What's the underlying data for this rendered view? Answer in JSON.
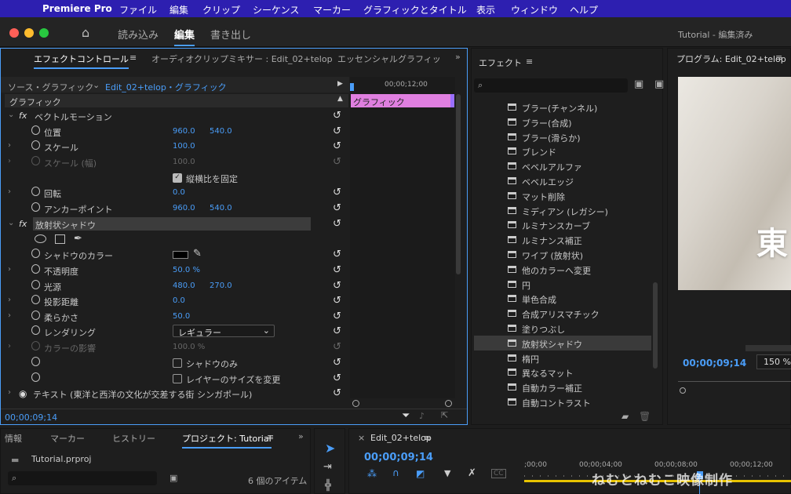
{
  "menubar": {
    "app": "Premiere Pro",
    "items": [
      "ファイル",
      "編集",
      "クリップ",
      "シーケンス",
      "マーカー",
      "グラフィックとタイトル",
      "表示",
      "ウィンドウ",
      "ヘルプ"
    ]
  },
  "workspace": {
    "tabs": [
      "読み込み",
      "編集",
      "書き出し"
    ],
    "active": "編集",
    "project_title": "Tutorial - 編集済み"
  },
  "effect_controls": {
    "tabs": [
      "エフェクトコントロール",
      "オーディオクリップミキサー : Edit_02+telop",
      "エッセンシャルグラフィック"
    ],
    "source": "ソース・グラフィック",
    "clip": "Edit_02+telop・グラフィック",
    "timecode_ruler": "00;00;12;00",
    "clip_bar": "グラフィック",
    "section": "グラフィック",
    "vector": {
      "name": "ベクトルモーション",
      "position_label": "位置",
      "position_x": "960.0",
      "position_y": "540.0",
      "scale_label": "スケール",
      "scale": "100.0",
      "scale_w_label": "スケール (幅)",
      "scale_w": "100.0",
      "lock_label": "縦横比を固定",
      "rotate_label": "回転",
      "rotate": "0.0",
      "anchor_label": "アンカーポイント",
      "anchor_x": "960.0",
      "anchor_y": "540.0"
    },
    "radial": {
      "name": "放射状シャドウ",
      "color_label": "シャドウのカラー",
      "opacity_label": "不透明度",
      "opacity": "50.0 %",
      "light_label": "光源",
      "light_x": "480.0",
      "light_y": "270.0",
      "distance_label": "投影距離",
      "distance": "0.0",
      "softness_label": "柔らかさ",
      "softness": "50.0",
      "render_label": "レンダリング",
      "render_value": "レギュラー",
      "influence_label": "カラーの影響",
      "influence": "100.0 %",
      "shadow_only": "シャドウのみ",
      "resize": "レイヤーのサイズを変更"
    },
    "text_layer": "テキスト (東洋と西洋の文化が交差する街 シンガポール)",
    "footer_time": "00;00;09;14"
  },
  "effects": {
    "title": "エフェクト",
    "items": [
      "ブラー(チャンネル)",
      "ブラー(合成)",
      "ブラー(滑らか)",
      "ブレンド",
      "ベベルアルファ",
      "ベベルエッジ",
      "マット削除",
      "ミディアン (レガシー)",
      "ルミナンスカーブ",
      "ルミナンス補正",
      "ワイプ (放射状)",
      "他のカラーへ変更",
      "円",
      "単色合成",
      "合成アリスマチック",
      "塗りつぶし",
      "放射状シャドウ",
      "楕円",
      "異なるマット",
      "自動カラー補正",
      "自動コントラスト"
    ],
    "selected": "放射状シャドウ"
  },
  "program": {
    "title": "プログラム: Edit_02+telop",
    "timecode": "00;00;09;14",
    "zoom": "150 %",
    "preview_text": "東"
  },
  "bottom_left": {
    "tabs": [
      "情報",
      "マーカー",
      "ヒストリー",
      "プロジェクト: Tutorial"
    ],
    "file": "Tutorial.prproj",
    "count": "6 個のアイテム"
  },
  "timeline": {
    "tab": "Edit_02+telop",
    "timecode": "00;00;09;14",
    "ruler": [
      ";00;00",
      "00;00;04;00",
      "00;00;08;00",
      "00;00;12;00"
    ]
  },
  "watermark": "ねむとねむこ映像制作",
  "colors": {
    "accent": "#4a9df8",
    "menubar": "#2d1fb0",
    "clip": "#e07fe0"
  }
}
